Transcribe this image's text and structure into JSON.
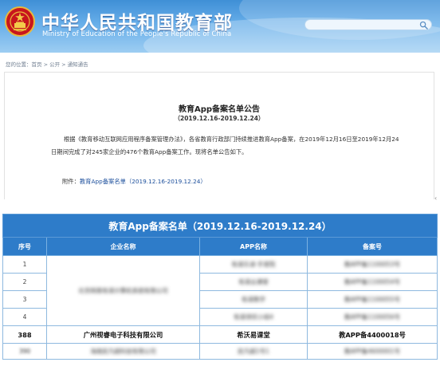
{
  "header": {
    "title": "中华人民共和国教育部",
    "subtitle": "Ministry of Education of the People's Republic of China",
    "search_placeholder": "",
    "emblem_icon": "national-emblem-icon",
    "search_icon": "search-icon",
    "colors": {
      "top": "#3f8fd6",
      "bottom": "#9dcdf2"
    }
  },
  "breadcrumb": "您的位置：首页 > 公开 > 通知通告",
  "notice": {
    "title": "教育App备案名单公告",
    "date_range": "（2019.12.16-2019.12.24）",
    "body": "根据《教育移动互联网应用程序备案管理办法》，各省教育行政部门持续推进教育App备案，在2019年12月16日至2019年12月24日期间完成了对245家企业的476个教育App备案工作。现将名单公告如下。",
    "attachment_label": "附件：",
    "attachment_link": "教育App备案名单（2019.12.16-2019.12.24）",
    "side_mark": "‹"
  },
  "registry_table": {
    "title": "教育App备案名单（2019.12.16-2019.12.24）",
    "headers": [
      "序号",
      "企业名称",
      "APP名称",
      "备案号"
    ],
    "header_color": "#2e7cc9",
    "rows": [
      {
        "no": "1",
        "company": "北京网易有道计算机系统有限公司",
        "app": "有道乐读·手查院",
        "record": "教APP备1100053号"
      },
      {
        "no": "2",
        "company": "",
        "app": "有道云课堂",
        "record": "教APP备1100054号"
      },
      {
        "no": "3",
        "company": "",
        "app": "有道数学",
        "record": "教APP备1100055号"
      },
      {
        "no": "4",
        "company": "",
        "app": "有道领优小组4",
        "record": "教APP备1100056号"
      },
      {
        "no": "388",
        "company": "广州视睿电子科技有限公司",
        "app": "希沃易课堂",
        "record": "教APP备4400018号"
      },
      {
        "no": "390",
        "company": "海南民凡超科技有限公司",
        "app": "民凡超1号1",
        "record": "教APP备4600001号"
      }
    ]
  }
}
